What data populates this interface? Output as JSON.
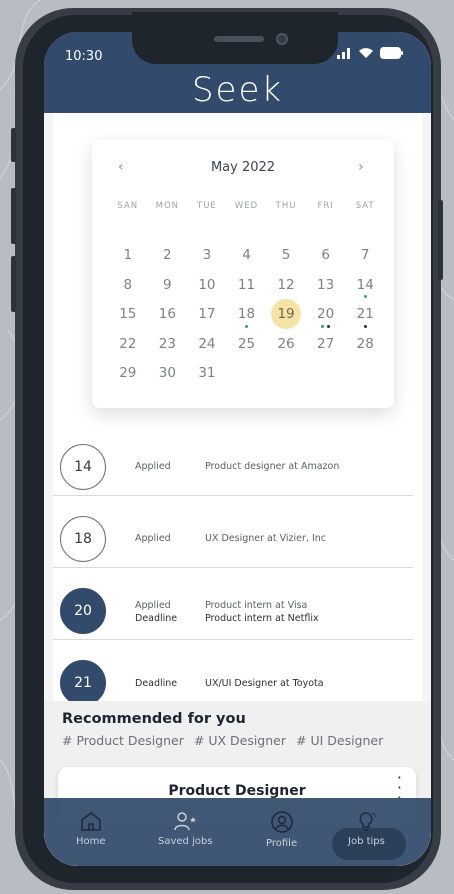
{
  "status_bar": {
    "time": "10:30"
  },
  "app": {
    "logo": "Seek"
  },
  "calendar": {
    "month_label": "May 2022",
    "prev_icon": "chevron-left-icon",
    "next_icon": "chevron-right-icon",
    "weekdays": [
      "SAN",
      "MON",
      "TUE",
      "WED",
      "THU",
      "FRI",
      "SAT"
    ],
    "days": [
      "1",
      "2",
      "3",
      "4",
      "5",
      "6",
      "7",
      "8",
      "9",
      "10",
      "11",
      "12",
      "13",
      "14",
      "15",
      "16",
      "17",
      "18",
      "19",
      "20",
      "21",
      "22",
      "23",
      "24",
      "25",
      "26",
      "27",
      "28",
      "29",
      "30",
      "31"
    ],
    "selected_day": "19",
    "highlight_color": "#f4e3a3",
    "marked_days": [
      {
        "day": "14",
        "dots": [
          "#2ea86b"
        ]
      },
      {
        "day": "18",
        "dots": [
          "#2ea86b"
        ]
      },
      {
        "day": "20",
        "dots": [
          "#2ea86b",
          "#2a2f38"
        ]
      },
      {
        "day": "21",
        "dots": [
          "#2a2f38"
        ]
      }
    ]
  },
  "applications": [
    {
      "day": "14",
      "filled": false,
      "status1": "Applied",
      "desc1": "Product designer at Amazon"
    },
    {
      "day": "18",
      "filled": false,
      "status1": "Applied",
      "desc1": "UX Designer at Vizier, Inc"
    },
    {
      "day": "20",
      "filled": true,
      "status1": "Applied",
      "desc1": "Product intern at Visa",
      "status2": "Deadline",
      "desc2": "Product intern at Netflix"
    },
    {
      "day": "21",
      "filled": true,
      "status1": "Deadline",
      "desc1": "UX/UI Designer at Toyota"
    }
  ],
  "recommended": {
    "title": "Recommended for you",
    "tags": [
      "# Product Designer",
      "# UX Designer",
      "# UI Designer"
    ],
    "card_title": "Product Designer",
    "card_menu_icon": "more-vertical-icon"
  },
  "nav": [
    {
      "label": "Home",
      "icon": "home-icon"
    },
    {
      "label": "Saved jobs",
      "icon": "saved-jobs-icon"
    },
    {
      "label": "Profile",
      "icon": "profile-icon"
    },
    {
      "label": "Job tips",
      "icon": "lightbulb-icon"
    }
  ],
  "colors": {
    "primary": "#324a6b",
    "background": "#b9bcc3"
  }
}
